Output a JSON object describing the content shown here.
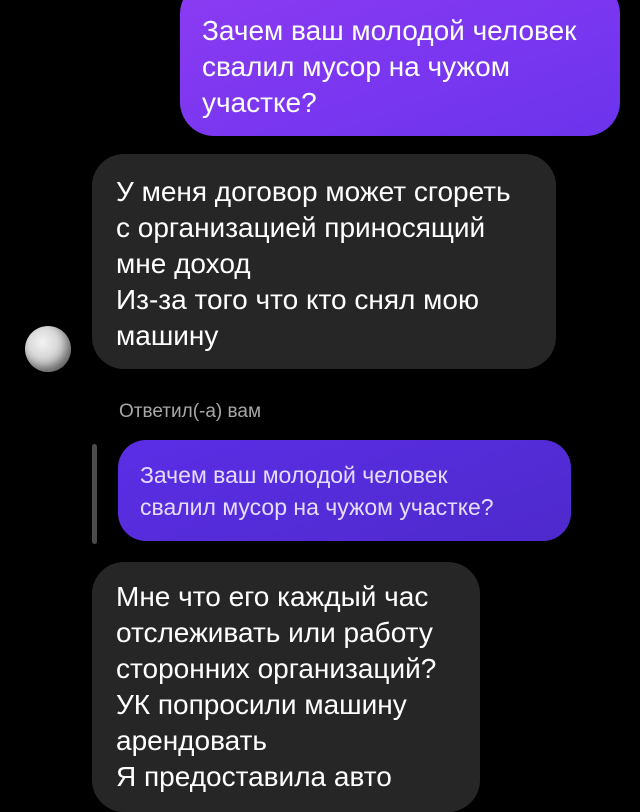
{
  "messages": {
    "outgoing": {
      "text": "Зачем ваш молодой человек\nсвалил мусор на чужом\nучастке?"
    },
    "incoming_1": {
      "text": "У меня договор может сгореть\nс организацией приносящий\nмне доход\nИз-за того что кто снял мою\nмашину"
    },
    "reply_label": "Ответил(-а) вам",
    "quoted": {
      "text": "Зачем ваш молодой человек\nсвалил мусор на чужом участке?"
    },
    "incoming_2": {
      "text": "Мне что его каждый час\nотслеживать или работу\nсторонних организаций?\nУК попросили машину\nарендовать\nЯ предоставила авто"
    }
  },
  "colors": {
    "background": "#000000",
    "outgoing_bubble": "#7a36f0",
    "incoming_bubble": "#262626",
    "quoted_bubble": "#5b2ee6",
    "secondary_text": "#a8a8a8"
  },
  "icons": {
    "avatar": "user-avatar"
  }
}
